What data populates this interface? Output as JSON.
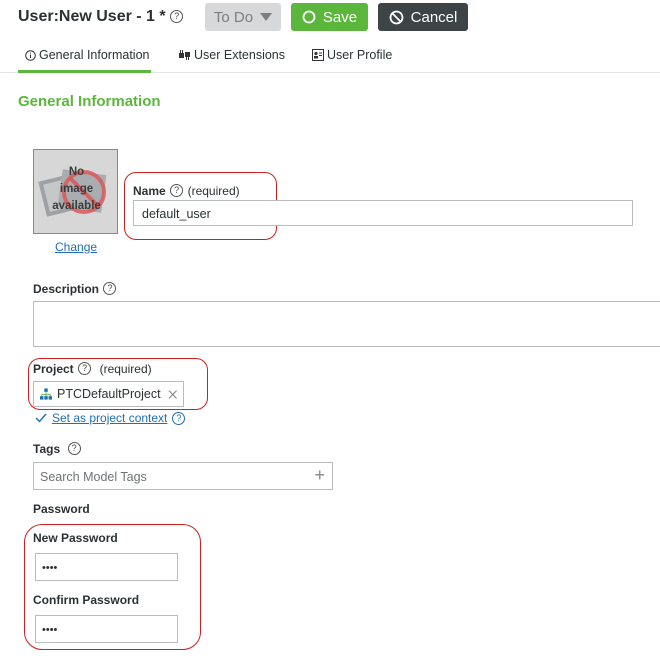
{
  "header": {
    "title": "User:New User - 1 *",
    "state_label": "To Do",
    "save_label": "Save",
    "cancel_label": "Cancel"
  },
  "tabs": [
    {
      "label": "General Information",
      "icon": "info-icon",
      "active": true
    },
    {
      "label": "User Extensions",
      "icon": "plug-icon",
      "active": false
    },
    {
      "label": "User Profile",
      "icon": "profile-card-icon",
      "active": false
    }
  ],
  "section_title": "General Information",
  "image": {
    "placeholder_line1": "No",
    "placeholder_line2": "image",
    "placeholder_line3": "available",
    "change_label": "Change"
  },
  "name": {
    "label": "Name",
    "required": "(required)",
    "value": "default_user"
  },
  "description": {
    "label": "Description",
    "value": ""
  },
  "project": {
    "label": "Project",
    "required": "(required)",
    "value": "PTCDefaultProject",
    "set_context_label": "Set as project context"
  },
  "tags": {
    "label": "Tags",
    "placeholder": "Search Model Tags"
  },
  "password": {
    "section_label": "Password",
    "new_label": "New Password",
    "new_value": "••••",
    "confirm_label": "Confirm Password",
    "confirm_value": "••••"
  },
  "colors": {
    "accent_green": "#5bb73b",
    "annotation_red": "#d11d1d",
    "link_blue": "#1f6fb6",
    "cancel_dark": "#3c4446"
  }
}
